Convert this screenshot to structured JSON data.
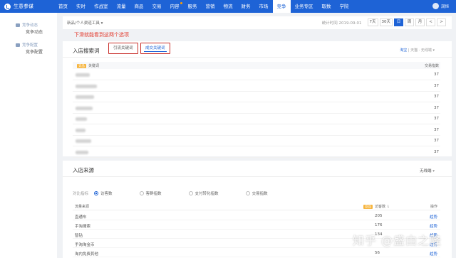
{
  "app": {
    "name": "生意参谋"
  },
  "nav": {
    "items": [
      "首页",
      "实时",
      "作战室",
      "流量",
      "商品",
      "交易",
      "内容",
      "服务",
      "营销",
      "物流",
      "财务",
      "市场",
      "竞争",
      "业务专区",
      "取数",
      "学院"
    ],
    "active_index": 12,
    "dot_index": 6,
    "user": "润恒"
  },
  "sidebar": {
    "sections": [
      {
        "title": "竞争动态",
        "links": [
          "竞争动态"
        ]
      },
      {
        "title": "竞争配置",
        "links": [
          "竞争配置"
        ]
      }
    ]
  },
  "toolbar": {
    "breadcrumb": "新品/个人渠道工具 ▾",
    "stat_time": "统计时间 2019-09-01",
    "buttons": [
      "7天",
      "30天",
      "日",
      "周",
      "月",
      "<",
      ">"
    ],
    "active_button": 2
  },
  "annotation": "下滑就能看到这两个选项",
  "card1": {
    "title": "入店搜索词",
    "tab1": "引流关键词",
    "tab2": "成交关键词",
    "right_hl": "淘宝",
    "right_rest": " | 天猫 · 无线端 ▾",
    "badge": "竞品",
    "col_keyword": "关键词",
    "col_value": "交易指数",
    "rows": [
      {
        "value": "37",
        "blur_width": 20
      },
      {
        "value": "37",
        "blur_width": 30
      },
      {
        "value": "37",
        "blur_width": 26
      },
      {
        "value": "37",
        "blur_width": 24
      },
      {
        "value": "37",
        "blur_width": 16
      },
      {
        "value": "37",
        "blur_width": 14
      },
      {
        "value": "37",
        "blur_width": 22
      },
      {
        "value": "37",
        "blur_width": 18
      }
    ]
  },
  "card2": {
    "title": "入店来源",
    "select": "无线端",
    "metrics_label": "对比指标",
    "metrics": [
      "访客数",
      "客群指数",
      "支付转化指数",
      "交易指数"
    ],
    "metric_selected": 0,
    "col_source": "流量来源",
    "badge": "竞品",
    "col_visitors": "访客数 ⇂",
    "col_action": "操作",
    "rows": [
      {
        "name": "直通车",
        "value": "205",
        "action": "趋势"
      },
      {
        "name": "手淘搜索",
        "value": "176",
        "action": "趋势"
      },
      {
        "name": "智钻",
        "value": "134",
        "action": "趋势"
      },
      {
        "name": "手淘淘金币",
        "value": "",
        "action": "趋势"
      },
      {
        "name": "淘内免费其他",
        "value": "56",
        "action": "趋势"
      }
    ]
  },
  "watermark": "知乎 @盛由之隆"
}
